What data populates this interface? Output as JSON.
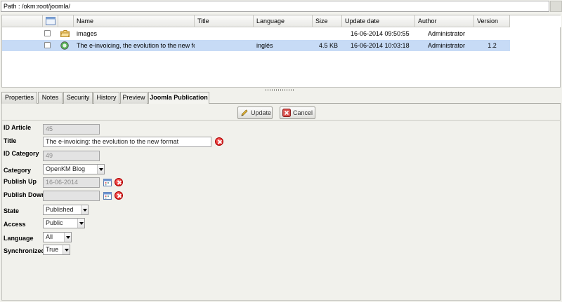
{
  "path": {
    "label": "Path : /okm:root/joomla/"
  },
  "table": {
    "headers": {
      "name": "Name",
      "title": "Title",
      "language": "Language",
      "size": "Size",
      "update_date": "Update date",
      "author": "Author",
      "version": "Version"
    },
    "rows": [
      {
        "icon": "folder-icon",
        "name": "images",
        "title": "",
        "language": "",
        "size": "",
        "update_date": "16-06-2014 09:50:55",
        "author": "Administrator",
        "version": ""
      },
      {
        "icon": "document-icon",
        "name": "The e-invoicing, the evolution to the new fom",
        "title": "",
        "language": "inglés",
        "size": "4.5 KB",
        "update_date": "16-06-2014 10:03:18",
        "author": "Administrator",
        "version": "1.2",
        "selected": true
      }
    ]
  },
  "tabs": [
    "Properties",
    "Notes",
    "Security",
    "History",
    "Preview",
    "Joomla Publication"
  ],
  "active_tab": "Joomla Publication",
  "buttons": {
    "update": "Update",
    "cancel": "Cancel"
  },
  "form": {
    "id_article": {
      "label": "ID Article",
      "value": "45"
    },
    "title": {
      "label": "Title",
      "value": "The e-invoicing: the evolution to the new format"
    },
    "id_category": {
      "label": "ID Category",
      "value": "49"
    },
    "category": {
      "label": "Category",
      "value": "OpenKM Blog"
    },
    "publish_up": {
      "label": "Publish Up",
      "value": "16-06-2014"
    },
    "publish_down": {
      "label": "Publish Down",
      "value": ""
    },
    "state": {
      "label": "State",
      "value": "Published"
    },
    "access": {
      "label": "Access",
      "value": "Public"
    },
    "language": {
      "label": "Language",
      "value": "All"
    },
    "synchronized": {
      "label": "Synchronized",
      "value": "True"
    }
  },
  "colors": {
    "selected_row": "#c7dbf6",
    "panel_bg": "#f1f1ec",
    "error_red": "#d30b0b"
  }
}
